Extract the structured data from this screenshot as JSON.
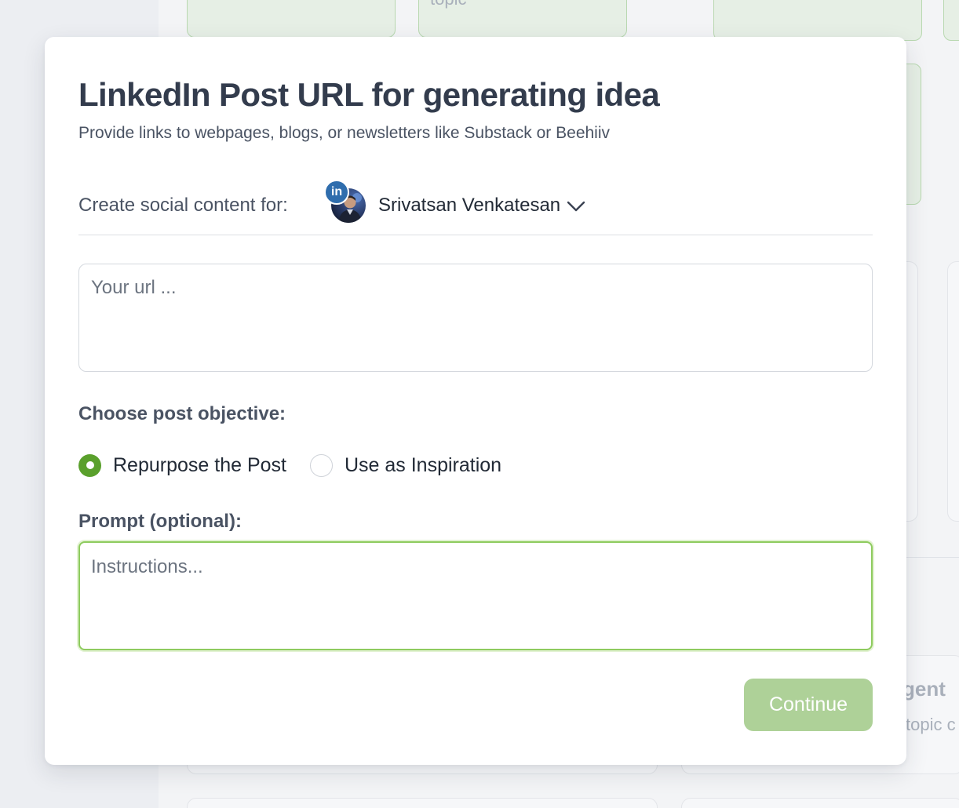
{
  "background": {
    "card_text_topic": "topic",
    "card_text_agent": "gent",
    "card_text_topic_c": "topic c"
  },
  "modal": {
    "title": "LinkedIn Post URL for generating idea",
    "subtitle": "Provide links to webpages, blogs, or newsletters like Substack or Beehiiv",
    "account": {
      "label": "Create social content for:",
      "platform_badge": "in",
      "platform_icon": "linkedin-icon",
      "name": "Srivatsan Venkatesan",
      "dropdown_icon": "chevron-down-icon"
    },
    "url_input": {
      "placeholder": "Your url ...",
      "value": ""
    },
    "objective": {
      "label": "Choose post objective:",
      "options": [
        {
          "label": "Repurpose the Post",
          "selected": true
        },
        {
          "label": "Use as Inspiration",
          "selected": false
        }
      ]
    },
    "prompt": {
      "label": "Prompt (optional):",
      "placeholder": "Instructions...",
      "value": ""
    },
    "continue_label": "Continue"
  },
  "colors": {
    "accent_green": "#5aa02c",
    "button_disabled_green": "#aed198",
    "focus_border": "#8ecb5e",
    "title_text": "#333c4d",
    "linkedin_blue": "#2f6dad"
  }
}
